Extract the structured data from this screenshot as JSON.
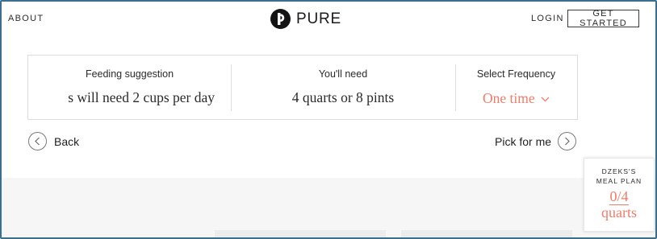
{
  "header": {
    "about_label": "ABOUT",
    "brand_name": "PURE",
    "login_label": "LOGIN",
    "get_started_label": "GET STARTED"
  },
  "summary": {
    "feeding": {
      "label": "Feeding suggestion",
      "value": "s will need 2 cups per day"
    },
    "need": {
      "label": "You'll need",
      "value": "4 quarts or 8 pints"
    },
    "frequency": {
      "label": "Select Frequency",
      "value": "One time"
    }
  },
  "navigation": {
    "back_label": "Back",
    "pick_label": "Pick for me"
  },
  "meal_plan": {
    "title_line1": "DZEKS'S",
    "title_line2": "MEAL PLAN",
    "count": "0/4",
    "unit": "quarts"
  },
  "colors": {
    "accent": "#f07c6a",
    "frame": "#3a6f8f",
    "text": "#1f1f1f"
  },
  "icons": {
    "brand": "pure-logo-icon",
    "back": "chevron-left-circle-icon",
    "pick": "chevron-right-circle-icon",
    "frequency": "chevron-down-icon"
  }
}
